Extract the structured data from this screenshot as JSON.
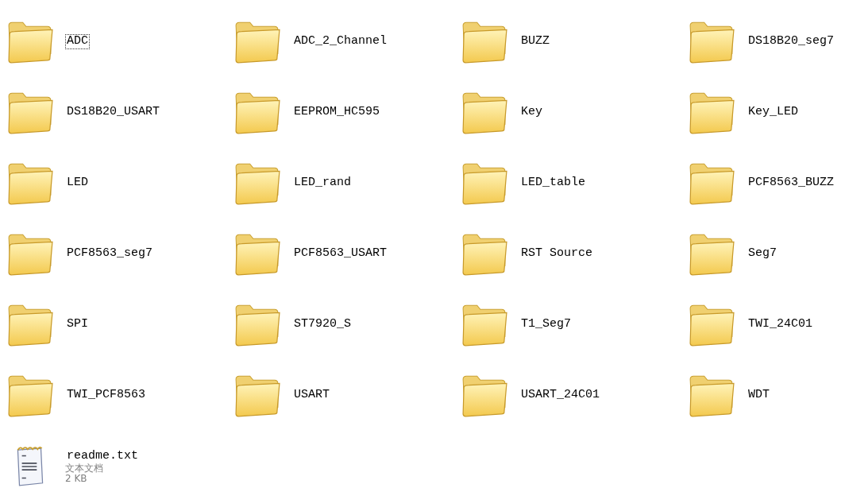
{
  "items": [
    {
      "kind": "folder",
      "name": "ADC",
      "focused": true
    },
    {
      "kind": "folder",
      "name": "ADC_2_Channel",
      "focused": false
    },
    {
      "kind": "folder",
      "name": "BUZZ",
      "focused": false
    },
    {
      "kind": "folder",
      "name": "DS18B20_seg7",
      "focused": false
    },
    {
      "kind": "folder",
      "name": "DS18B20_USART",
      "focused": false
    },
    {
      "kind": "folder",
      "name": "EEPROM_HC595",
      "focused": false
    },
    {
      "kind": "folder",
      "name": "Key",
      "focused": false
    },
    {
      "kind": "folder",
      "name": "Key_LED",
      "focused": false
    },
    {
      "kind": "folder",
      "name": "LED",
      "focused": false
    },
    {
      "kind": "folder",
      "name": "LED_rand",
      "focused": false
    },
    {
      "kind": "folder",
      "name": "LED_table",
      "focused": false
    },
    {
      "kind": "folder",
      "name": "PCF8563_BUZZ",
      "focused": false
    },
    {
      "kind": "folder",
      "name": "PCF8563_seg7",
      "focused": false
    },
    {
      "kind": "folder",
      "name": "PCF8563_USART",
      "focused": false
    },
    {
      "kind": "folder",
      "name": "RST Source",
      "focused": false
    },
    {
      "kind": "folder",
      "name": "Seg7",
      "focused": false
    },
    {
      "kind": "folder",
      "name": "SPI",
      "focused": false
    },
    {
      "kind": "folder",
      "name": "ST7920_S",
      "focused": false
    },
    {
      "kind": "folder",
      "name": "T1_Seg7",
      "focused": false
    },
    {
      "kind": "folder",
      "name": "TWI_24C01",
      "focused": false
    },
    {
      "kind": "folder",
      "name": "TWI_PCF8563",
      "focused": false
    },
    {
      "kind": "folder",
      "name": "USART",
      "focused": false
    },
    {
      "kind": "folder",
      "name": "USART_24C01",
      "focused": false
    },
    {
      "kind": "folder",
      "name": "WDT",
      "focused": false
    },
    {
      "kind": "file",
      "name": "readme.txt",
      "type": "文本文档",
      "size": "2 KB",
      "focused": false
    }
  ]
}
